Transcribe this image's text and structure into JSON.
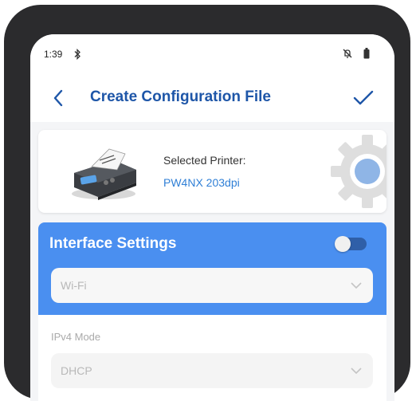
{
  "status_bar": {
    "time": "1:39",
    "icons": [
      "bluetooth-icon",
      "mute-icon",
      "battery-icon"
    ]
  },
  "app_bar": {
    "title": "Create Configuration File",
    "back_icon": "chevron-left-icon",
    "confirm_icon": "checkmark-icon"
  },
  "printer": {
    "label": "Selected Printer:",
    "name": "PW4NX 203dpi",
    "settings_icon": "gear-icon"
  },
  "interface": {
    "title": "Interface Settings",
    "toggle_on": false,
    "connection_value": "Wi-Fi"
  },
  "ipv4": {
    "label": "IPv4 Mode",
    "value": "DHCP"
  },
  "colors": {
    "accent": "#1e56a8",
    "link": "#2f7fd6",
    "panel": "#4a8ff0"
  }
}
